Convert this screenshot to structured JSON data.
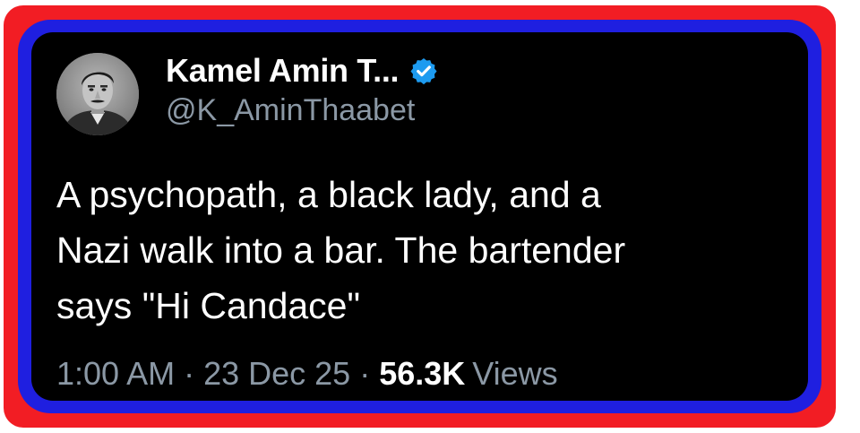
{
  "tweet": {
    "display_name": "Kamel Amin T...",
    "handle": "@K_AminThaabet",
    "verified": true,
    "avatar_icon": "profile-photo",
    "text": "A psychopath, a black lady, and a\nNazi walk into a bar.  The bartender\nsays \"Hi Candace\"",
    "time": "1:00 AM",
    "separator": "·",
    "date": "23 Dec 25",
    "views_count": "56.3K",
    "views_label": "Views"
  },
  "colors": {
    "outer_border": "#f21d24",
    "inner_border": "#1f1fe0",
    "card_bg": "#000000",
    "secondary_text": "#8b98a5",
    "verified_badge": "#1d9bf0"
  }
}
